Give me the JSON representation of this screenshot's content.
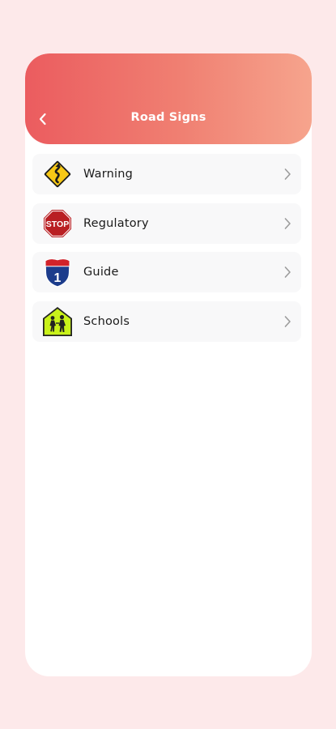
{
  "header": {
    "title": "Road Signs",
    "back_icon": "chevron-left-icon"
  },
  "categories": [
    {
      "label": "Warning",
      "icon": "winding-road-sign-icon"
    },
    {
      "label": "Regulatory",
      "icon": "stop-sign-icon"
    },
    {
      "label": "Guide",
      "icon": "interstate-shield-icon"
    },
    {
      "label": "Schools",
      "icon": "school-crossing-sign-icon"
    }
  ],
  "stop_sign_text": "STOP",
  "interstate_number": "1",
  "colors": {
    "background": "#fde9ea",
    "header_gradient_start": "#eb5c5f",
    "header_gradient_end": "#f6a48d",
    "item_background": "#f8f8f9",
    "chevron": "#9b9b9b"
  }
}
